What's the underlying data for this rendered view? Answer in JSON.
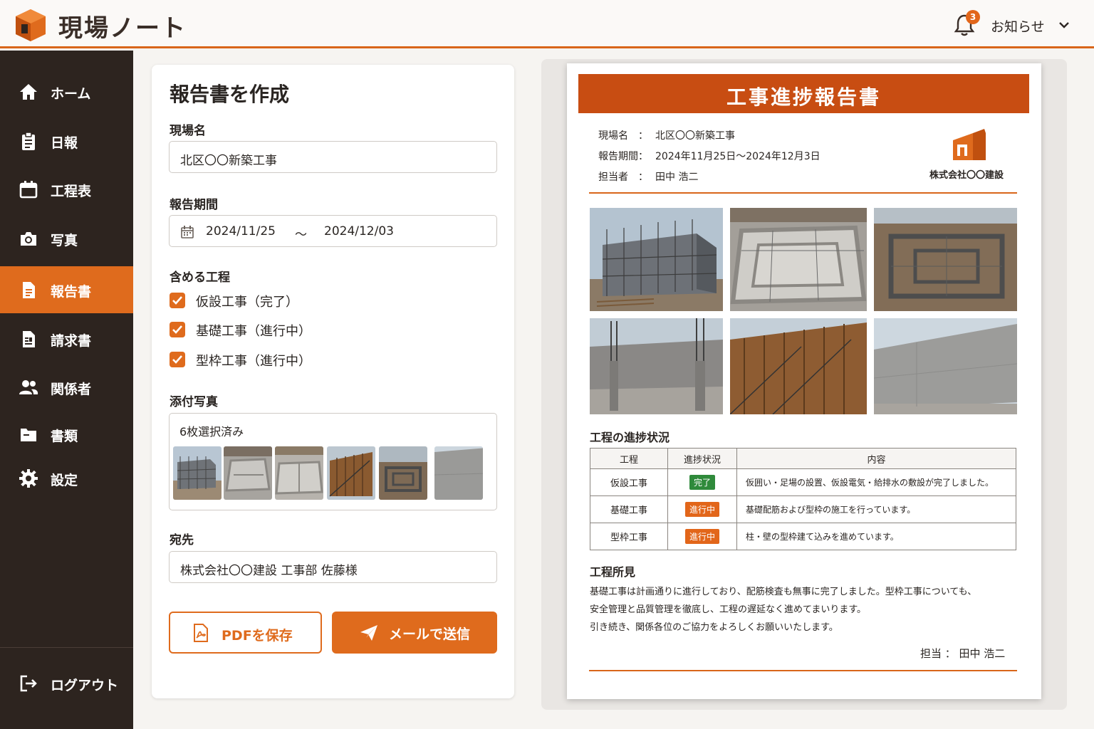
{
  "header": {
    "app_title": "現場ノート",
    "notification_count": "3",
    "notice_label": "お知らせ"
  },
  "sidebar": {
    "items": [
      {
        "label": "ホーム",
        "icon": "home-icon"
      },
      {
        "label": "日報",
        "icon": "clipboard-icon"
      },
      {
        "label": "工程表",
        "icon": "calendar-icon"
      },
      {
        "label": "写真",
        "icon": "camera-icon"
      },
      {
        "label": "報告書",
        "icon": "document-icon",
        "active": true
      },
      {
        "label": "請求書",
        "icon": "invoice-icon"
      },
      {
        "label": "関係者",
        "icon": "people-icon"
      },
      {
        "label": "書類",
        "icon": "folder-icon"
      },
      {
        "label": "設定",
        "icon": "gear-icon"
      }
    ],
    "logout_label": "ログアウト"
  },
  "form": {
    "title": "報告書を作成",
    "site_label": "現場名",
    "site_value": "北区〇〇新築工事",
    "period_label": "報告期間",
    "period_start": "2024/11/25",
    "period_sep": "〜",
    "period_end": "2024/12/03",
    "process_label": "含める工程",
    "processes": [
      {
        "label": "仮設工事（完了）",
        "checked": true
      },
      {
        "label": "基礎工事（進行中）",
        "checked": true
      },
      {
        "label": "型枠工事（進行中）",
        "checked": true
      }
    ],
    "photos_label": "添付写真",
    "photos_selected": "6枚選択済み",
    "recipient_label": "宛先",
    "recipient_value": "株式会社〇〇建設 工事部 佐藤様",
    "pdf_button": "PDFを保存",
    "mail_button": "メールで送信"
  },
  "report": {
    "title": "工事進捗報告書",
    "meta": [
      {
        "key": "現場名　：",
        "value": "北区〇〇新築工事"
      },
      {
        "key": "報告期間：",
        "value": "2024年11月25日〜2024年12月3日"
      },
      {
        "key": "担当者　：",
        "value": "田中 浩二"
      }
    ],
    "company": "株式会社〇〇建設",
    "progress_title": "工程の進捗状況",
    "table_headers": [
      "工程",
      "進捗状況",
      "内容"
    ],
    "table_rows": [
      {
        "process": "仮設工事",
        "status": "完了",
        "detail": "仮囲い・足場の設置、仮設電気・給排水の敷設が完了しました。"
      },
      {
        "process": "基礎工事",
        "status": "進行中",
        "detail": "基礎配筋および型枠の施工を行っています。"
      },
      {
        "process": "型枠工事",
        "status": "進行中",
        "detail": "柱・壁の型枠建て込みを進めています。"
      }
    ],
    "observations_title": "工程所見",
    "observations": [
      "基礎工事は計画通りに進行しており、配筋検査も無事に完了しました。型枠工事についても、",
      "安全管理と品質管理を徹底し、工程の遅延なく進めてまいります。",
      "引き続き、関係各位のご協力をよろしくお願いいたします。"
    ],
    "signer": "担当 ： 田中 浩二"
  },
  "colors": {
    "accent": "#df6b1d",
    "banner": "#c84d12",
    "sidebar": "#2d241f",
    "done": "#2f8a3b"
  }
}
